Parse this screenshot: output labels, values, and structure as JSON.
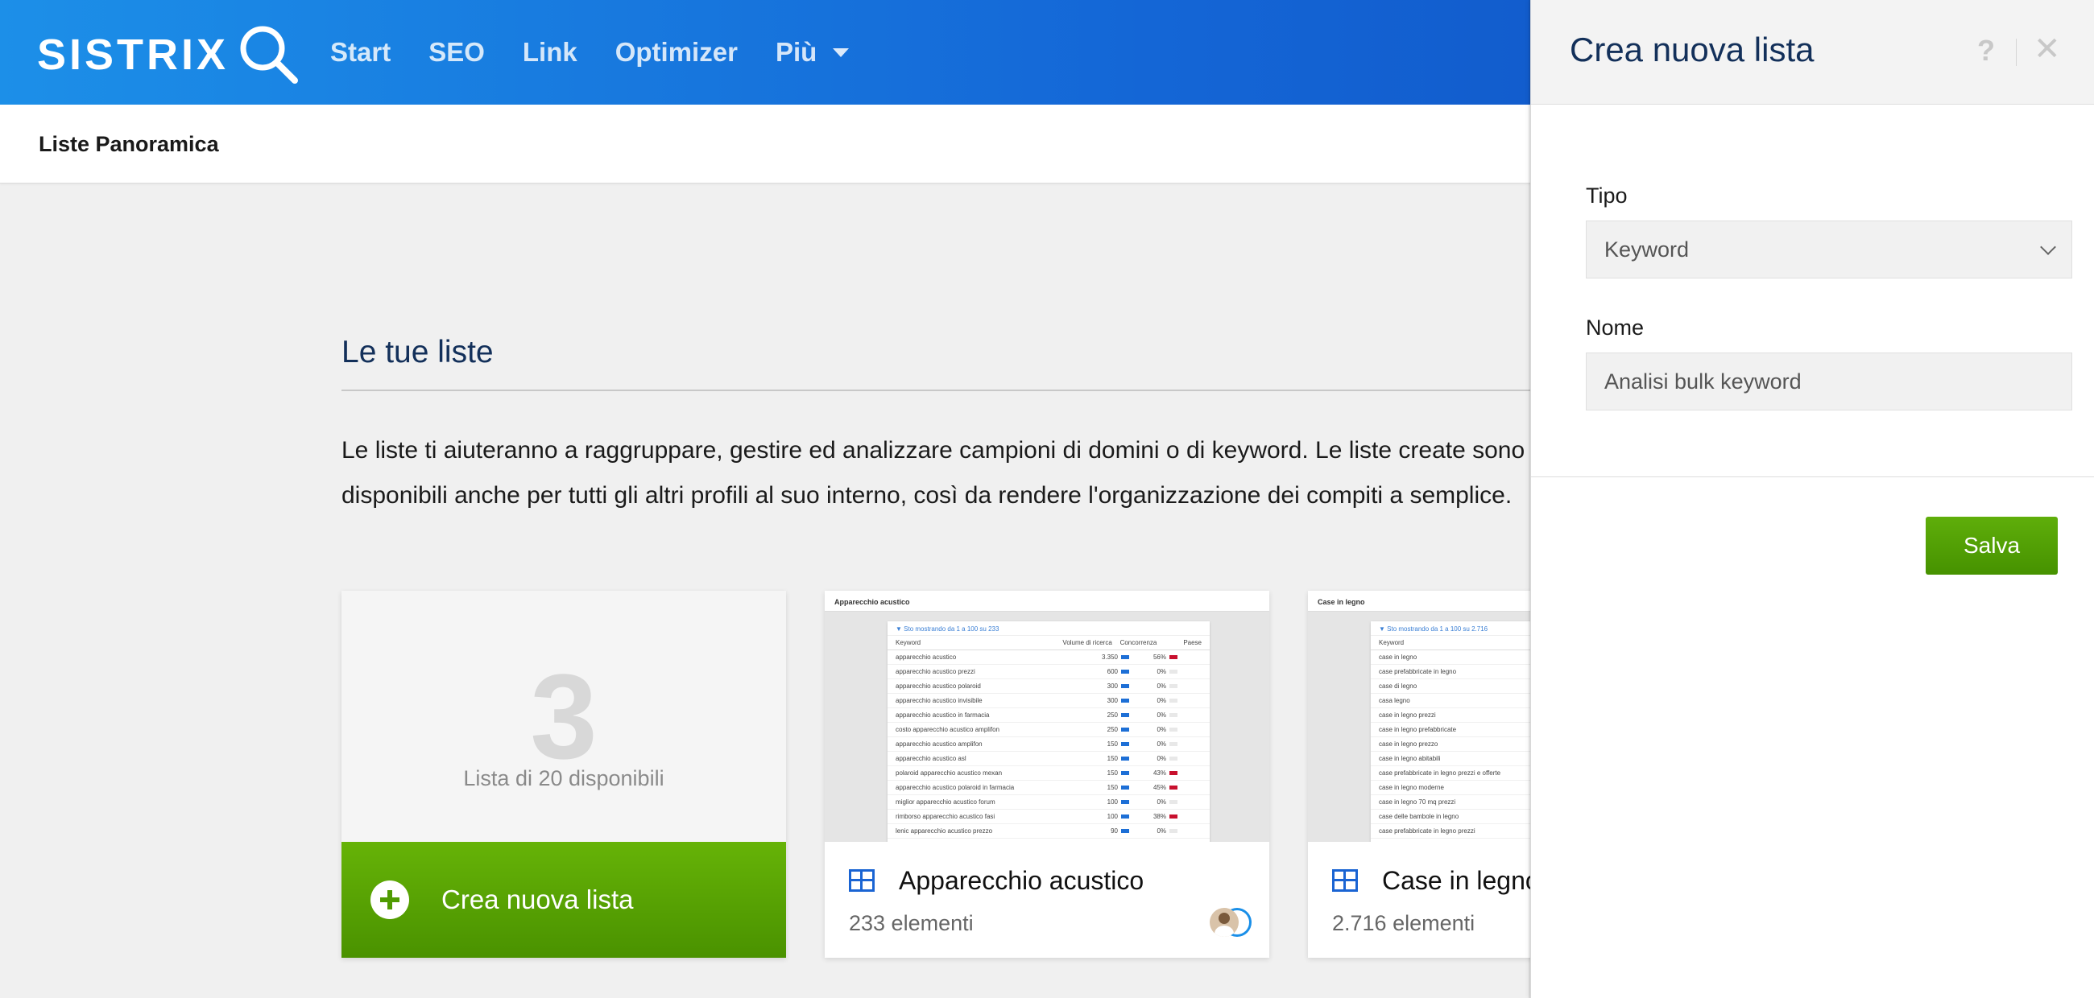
{
  "brand": {
    "name": "SISTRIX"
  },
  "nav": {
    "items": [
      "Start",
      "SEO",
      "Link",
      "Optimizer",
      "Più"
    ]
  },
  "subheader": {
    "title": "Liste Panoramica"
  },
  "main": {
    "section_title": "Le tue liste",
    "intro": "Le liste ti aiuteranno a raggruppare, gestire ed analizzare campioni di domini o di keyword. Le liste create sono disponibili anche per tutti gli altri profili al suo interno, così da rendere l'organizzazione dei compiti a semplice.",
    "new_card": {
      "count": "3",
      "availability": "Lista di 20 disponibili",
      "create_label": "Crea nuova lista"
    },
    "lists": [
      {
        "title": "Apparecchio acustico",
        "count": "233 elementi",
        "thumb": {
          "header": "Apparecchio acustico",
          "filter": "Sto mostrando da 1 a 100 su 233",
          "columns": [
            "Keyword",
            "Volume di ricerca",
            "Concorrenza",
            "Paese"
          ],
          "rows": [
            [
              "apparecchio acustico",
              "3.350",
              "56%"
            ],
            [
              "apparecchio acustico prezzi",
              "600",
              "0%"
            ],
            [
              "apparecchio acustico polaroid",
              "300",
              "0%"
            ],
            [
              "apparecchio acustico invisibile",
              "300",
              "0%"
            ],
            [
              "apparecchio acustico in farmacia",
              "250",
              "0%"
            ],
            [
              "costo apparecchio acustico amplifon",
              "250",
              "0%"
            ],
            [
              "apparecchio acustico amplifon",
              "150",
              "0%"
            ],
            [
              "apparecchio acustico asl",
              "150",
              "0%"
            ],
            [
              "polaroid apparecchio acustico mexan",
              "150",
              "43%"
            ],
            [
              "apparecchio acustico polaroid in farmacia",
              "150",
              "45%"
            ],
            [
              "miglior apparecchio acustico forum",
              "100",
              "0%"
            ],
            [
              "rimborso apparecchio acustico fasi",
              "100",
              "38%"
            ],
            [
              "lenic apparecchio acustico prezzo",
              "90",
              "0%"
            ]
          ]
        }
      },
      {
        "title": "Case in legno",
        "count": "2.716 elementi",
        "thumb": {
          "header": "Case in legno",
          "filter": "Sto mostrando da 1 a 100 su 2.716",
          "columns": [
            "Keyword"
          ],
          "rows": [
            [
              "case in legno"
            ],
            [
              "case prefabbricate in legno"
            ],
            [
              "case di legno"
            ],
            [
              "casa legno"
            ],
            [
              "case in legno prezzi"
            ],
            [
              "case in legno prefabbricate"
            ],
            [
              "case in legno prezzo"
            ],
            [
              "case in legno abitabili"
            ],
            [
              "case prefabbricate in legno prezzi e offerte"
            ],
            [
              "case in legno moderne"
            ],
            [
              "case in legno 70 mq prezzi"
            ],
            [
              "case delle bambole in legno"
            ],
            [
              "case prefabbricate in legno prezzi"
            ]
          ]
        }
      }
    ]
  },
  "panel": {
    "title": "Crea nuova lista",
    "help": "?",
    "close": "✕",
    "type_label": "Tipo",
    "type_value": "Keyword",
    "name_label": "Nome",
    "name_value": "Analisi bulk keyword",
    "save_label": "Salva"
  },
  "colors": {
    "header_blue": "#1466d6",
    "accent_green": "#5fae0a",
    "title_navy": "#13305a"
  },
  "icons": [
    "search-icon",
    "caret-down-icon",
    "plus-circle-icon",
    "grid-icon",
    "help-icon",
    "close-icon",
    "chevron-down-icon"
  ]
}
